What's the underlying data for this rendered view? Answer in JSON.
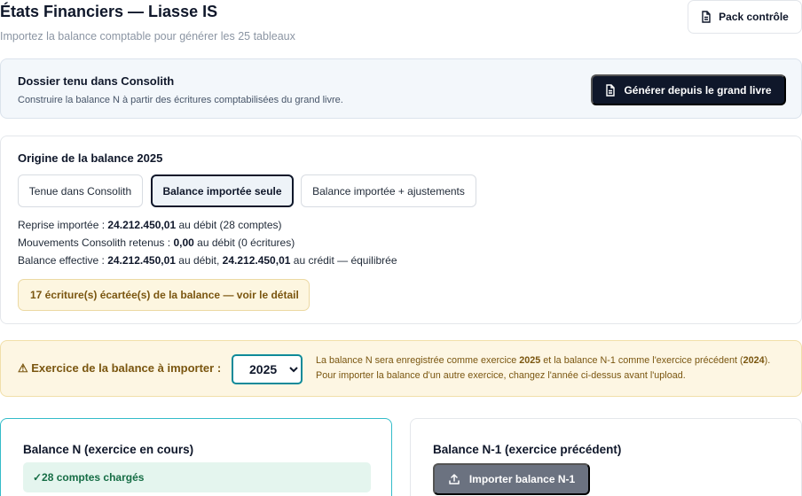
{
  "header": {
    "title": "États Financiers — Liasse IS",
    "subtitle": "Importez la balance comptable pour générer les 25 tableaux",
    "pack_button": "Pack contrôle"
  },
  "consolith": {
    "title": "Dossier tenu dans Consolith",
    "description": "Construire la balance N à partir des écritures comptabilisées du grand livre.",
    "generate_button": "Générer depuis le grand livre"
  },
  "origin": {
    "title": "Origine de la balance 2025",
    "options": [
      {
        "label": "Tenue dans Consolith",
        "active": false
      },
      {
        "label": "Balance importée seule",
        "active": true
      },
      {
        "label": "Balance importée + ajustements",
        "active": false
      }
    ],
    "reprise": {
      "label": "Reprise importée :",
      "amount": "24.212.450,01",
      "suffix": "au débit (28 comptes)"
    },
    "mouvements": {
      "label": "Mouvements Consolith retenus :",
      "amount": "0,00",
      "suffix": "au débit (0 écritures)"
    },
    "effective": {
      "label": "Balance effective :",
      "debit": "24.212.450,01",
      "mid": "au débit,",
      "credit": "24.212.450,01",
      "suffix": "au crédit — équilibrée"
    },
    "ecart_notice": "17 écriture(s) écartée(s) de la balance — voir le détail"
  },
  "exercice": {
    "label": "⚠ Exercice de la balance à importer :",
    "selected_year": "2025",
    "note_line1_pre": "La balance N sera enregistrée comme exercice",
    "note_year_n": "2025",
    "note_line1_mid": "et la balance N-1 comme l'exercice précédent (",
    "note_year_n1": "2024",
    "note_line1_post": ").",
    "note_line2": "Pour importer la balance d'un autre exercice, changez l'année ci-dessus avant l'upload."
  },
  "balance_n": {
    "title": "Balance N (exercice en cours)",
    "status": "✓28 comptes chargés"
  },
  "balance_n1": {
    "title": "Balance N-1 (exercice précédent)",
    "import_button": "Importer balance N-1"
  },
  "colors": {
    "primary_dark": "#0f172a",
    "accent_teal": "#0e8a99",
    "warning_bg": "#fdf6e3",
    "warning_text": "#7a5610",
    "success_bg": "#e4f5ee",
    "success_text": "#166d45"
  }
}
